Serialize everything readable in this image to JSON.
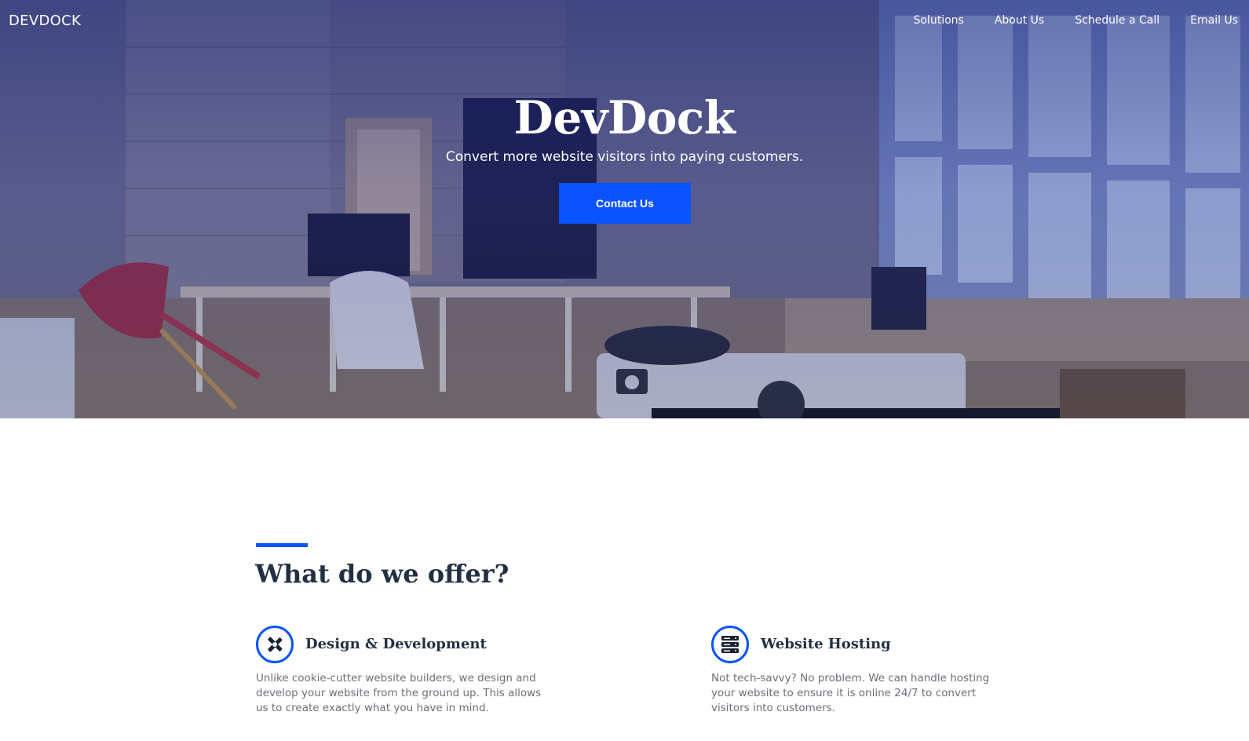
{
  "nav": {
    "brand": "DEVDOCK",
    "links": [
      "Solutions",
      "About Us",
      "Schedule a Call",
      "Email Us"
    ]
  },
  "hero": {
    "title": "DevDock",
    "subtitle": "Convert more website visitors into paying customers.",
    "cta_label": "Contact Us"
  },
  "offer": {
    "heading": "What do we offer?",
    "features": [
      {
        "icon": "design-development-icon",
        "title": "Design & Development",
        "text": "Unlike cookie-cutter website builders, we design and develop your website from the ground up. This allows us to create exactly what you have in mind."
      },
      {
        "icon": "server-icon",
        "title": "Website Hosting",
        "text": "Not tech-savvy? No problem. We can handle hosting your website to ensure it is online 24/7 to convert visitors into customers."
      }
    ]
  },
  "colors": {
    "accent": "#0a53ff",
    "heading": "#233043",
    "body_text": "#6b6f76",
    "hero_overlay": "#1e288c"
  }
}
